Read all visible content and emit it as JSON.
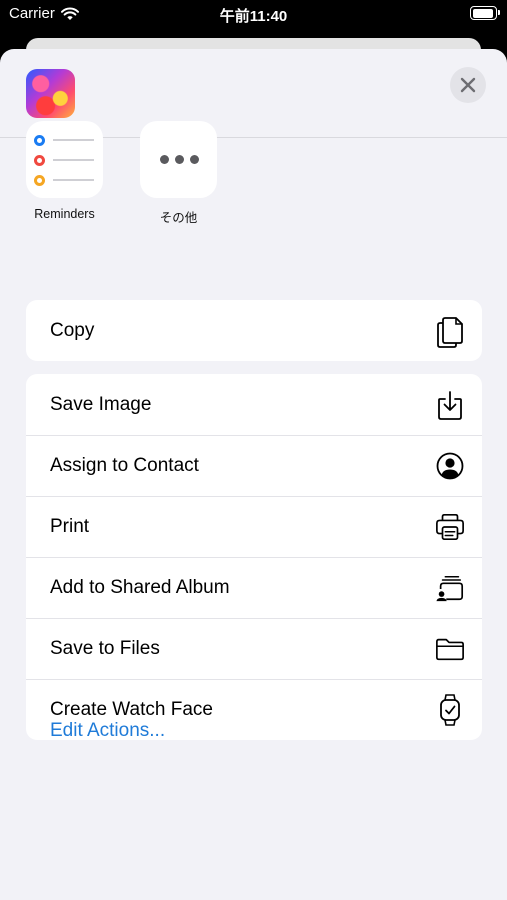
{
  "status_bar": {
    "carrier": "Carrier",
    "time": "午前11:40"
  },
  "share_sheet": {
    "close_icon": "close-icon",
    "apps": [
      {
        "label": "Reminders",
        "icon": "reminders-app-icon",
        "dot_colors": [
          "#1a7cf2",
          "#f0493f",
          "#f5a623"
        ]
      },
      {
        "label": "その他",
        "icon": "more-icon"
      }
    ],
    "actions_primary": [
      {
        "label": "Copy",
        "icon": "copy-icon"
      }
    ],
    "actions": [
      {
        "label": "Save Image",
        "icon": "save-image-icon"
      },
      {
        "label": "Assign to Contact",
        "icon": "contact-icon"
      },
      {
        "label": "Print",
        "icon": "printer-icon"
      },
      {
        "label": "Add to Shared Album",
        "icon": "shared-album-icon"
      },
      {
        "label": "Save to Files",
        "icon": "folder-icon"
      },
      {
        "label": "Create Watch Face",
        "icon": "watch-icon"
      }
    ],
    "edit_actions": "Edit Actions..."
  },
  "colors": {
    "link": "#1f7bd8",
    "sheet_bg": "#f2f2f7"
  }
}
